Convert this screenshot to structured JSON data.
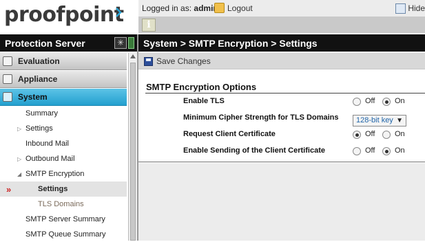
{
  "brand": {
    "logo_text": "proofpoint"
  },
  "header": {
    "logged_in_prefix": "Logged in as:",
    "username": "admin",
    "logout_label": "Logout",
    "hide_label": "Hide",
    "info_label": "i"
  },
  "sidebar": {
    "title": "Protection Server",
    "sections": [
      {
        "label": "Evaluation",
        "icon": "clipboard-icon"
      },
      {
        "label": "Appliance",
        "icon": "monitor-icon"
      },
      {
        "label": "System",
        "icon": "tools-icon",
        "active": true
      }
    ],
    "items": [
      {
        "label": "Summary"
      },
      {
        "label": "Settings"
      },
      {
        "label": "Inbound Mail"
      },
      {
        "label": "Outbound Mail"
      },
      {
        "label": "SMTP Encryption"
      },
      {
        "label": "Settings"
      },
      {
        "label": "TLS Domains"
      },
      {
        "label": "SMTP Server Summary"
      },
      {
        "label": "SMTP Queue Summary"
      }
    ],
    "selected_marker": "»"
  },
  "main": {
    "breadcrumb": "System > SMTP Encryption > Settings",
    "save_label": "Save Changes",
    "section_title": "SMTP Encryption Options",
    "options": [
      {
        "label": "Enable TLS",
        "off": "Off",
        "on": "On",
        "value": "On"
      },
      {
        "label": "Minimum Cipher Strength for TLS Domains",
        "value": "128-bit key"
      },
      {
        "label": "Request Client Certificate",
        "off": "Off",
        "on": "On",
        "value": "Off"
      },
      {
        "label": "Enable Sending of the Client Certificate",
        "off": "Off",
        "on": "On",
        "value": "On"
      }
    ]
  }
}
